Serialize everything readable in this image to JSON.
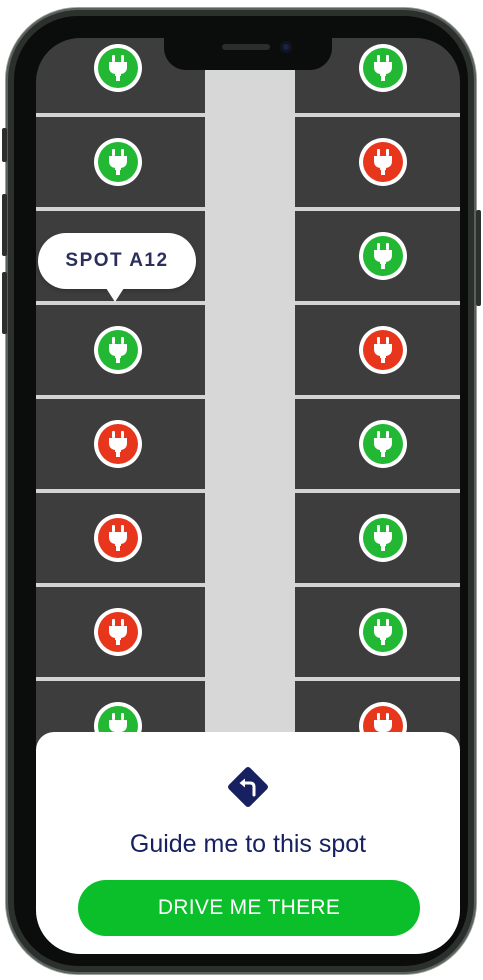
{
  "parking_lot": {
    "left_column": [
      {
        "id": "L1",
        "status": "available"
      },
      {
        "id": "L2",
        "status": "available"
      },
      {
        "id": "L3",
        "status": "hidden"
      },
      {
        "id": "L4",
        "status": "available"
      },
      {
        "id": "L5",
        "status": "occupied"
      },
      {
        "id": "L6",
        "status": "occupied"
      },
      {
        "id": "L7",
        "status": "occupied"
      },
      {
        "id": "L8",
        "status": "available"
      }
    ],
    "right_column": [
      {
        "id": "R1",
        "status": "available"
      },
      {
        "id": "R2",
        "status": "occupied"
      },
      {
        "id": "R3",
        "status": "available"
      },
      {
        "id": "R4",
        "status": "occupied"
      },
      {
        "id": "R5",
        "status": "available"
      },
      {
        "id": "R6",
        "status": "available"
      },
      {
        "id": "R7",
        "status": "available"
      },
      {
        "id": "R8",
        "status": "occupied"
      }
    ],
    "selected_spot_label": "SPOT A12",
    "colors": {
      "available": "#22b833",
      "occupied": "#e8361d",
      "asphalt": "#3d3d3d",
      "aisle": "#d7d7d7"
    }
  },
  "bottom_sheet": {
    "direction_icon": "turn-left-sign-icon",
    "title": "Guide me to this spot",
    "cta_label": "DRIVE ME THERE",
    "cta_color": "#0bbf2a",
    "title_color": "#172060"
  }
}
